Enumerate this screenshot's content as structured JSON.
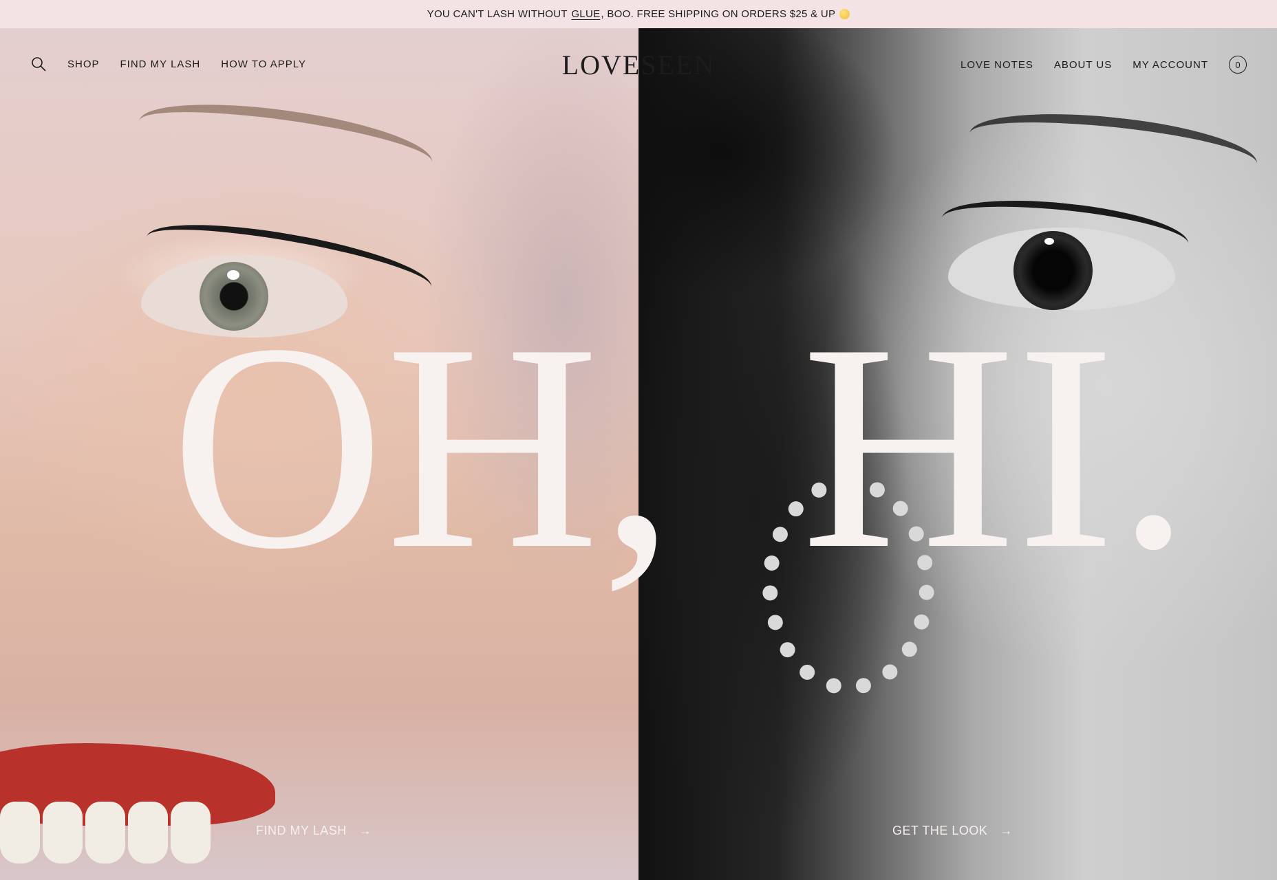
{
  "announcement": {
    "before": "YOU CAN'T LASH WITHOUT",
    "link": "GLUE",
    "after": ", BOO. FREE SHIPPING ON ORDERS $25 & UP",
    "emoji_icon": "smiling-face-emoji"
  },
  "header": {
    "logo": "LOVESEEN",
    "nav_left": [
      "SHOP",
      "FIND MY LASH",
      "HOW TO APPLY"
    ],
    "nav_right": [
      "LOVE NOTES",
      "ABOUT US",
      "MY ACCOUNT"
    ],
    "cart_count": "0"
  },
  "hero": {
    "headline_left": "OH,",
    "headline_right": "HI.",
    "cta_left": "FIND MY LASH",
    "cta_right": "GET THE LOOK",
    "arrow": "→"
  },
  "colors": {
    "announcement_bg": "#f3e3e5",
    "text": "#1c1c1c",
    "headline": "#f7f1ef"
  }
}
